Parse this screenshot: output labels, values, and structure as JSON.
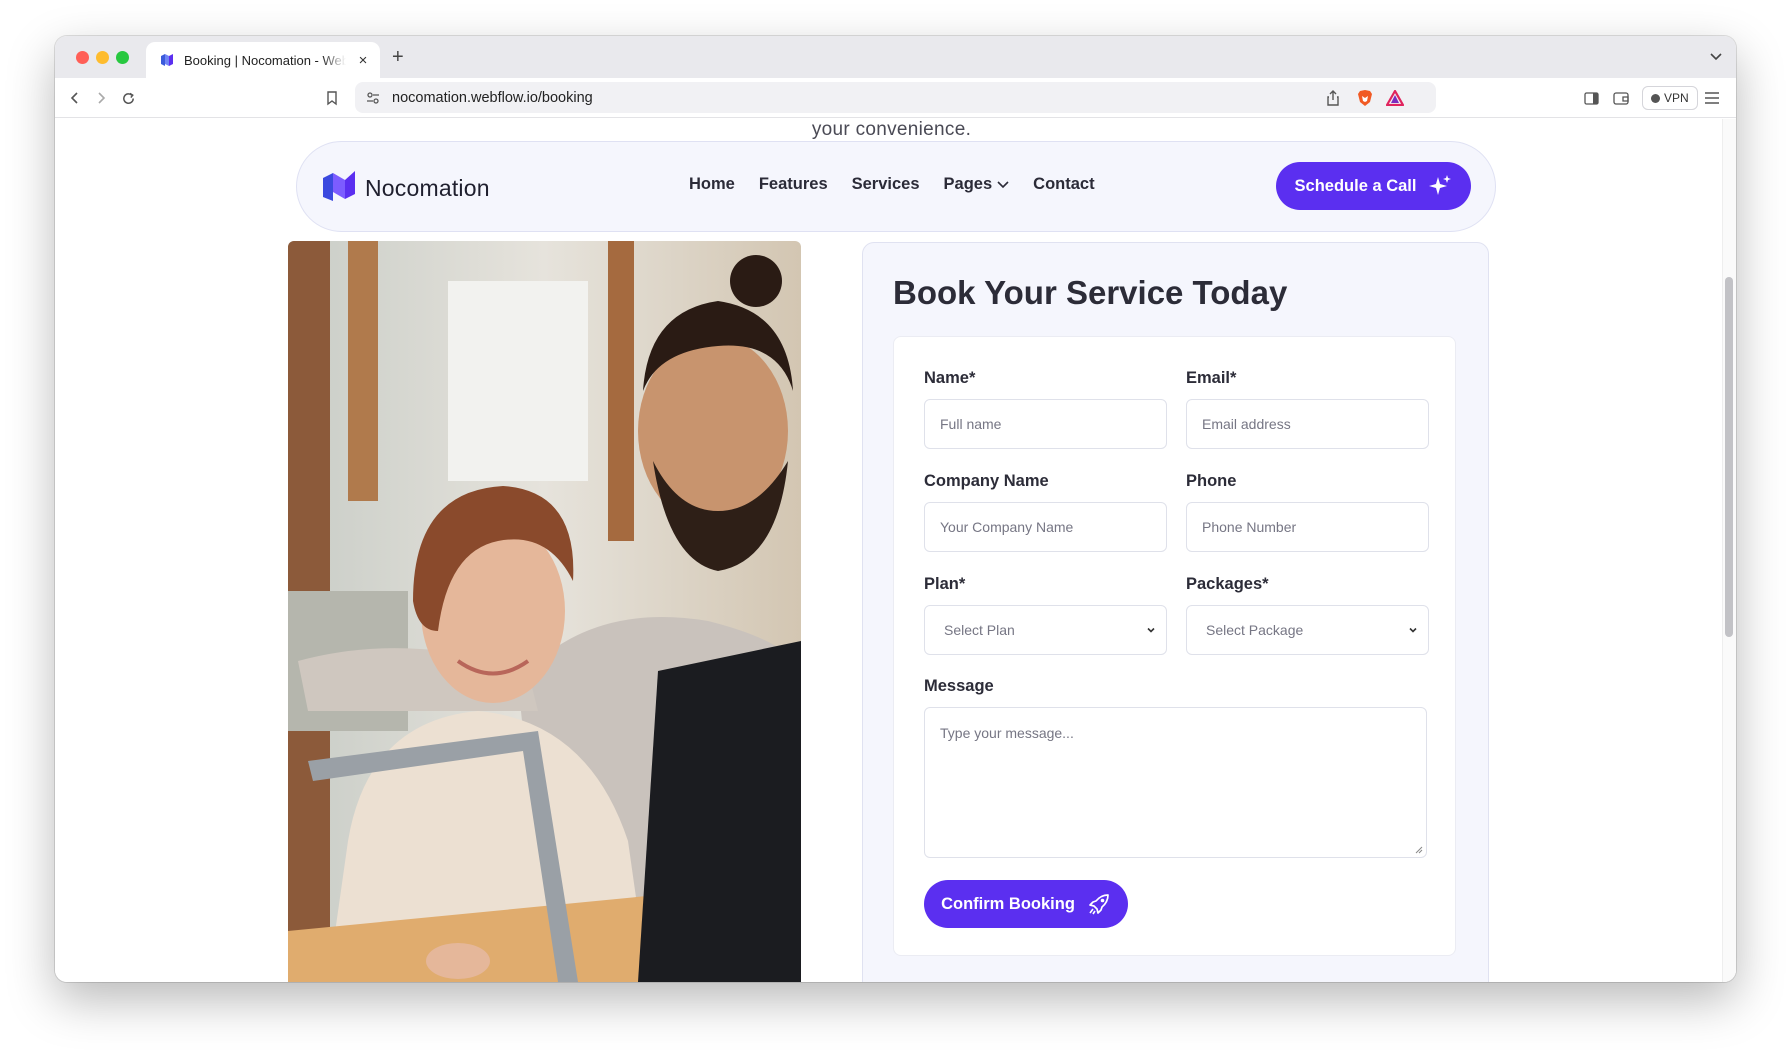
{
  "browser": {
    "tab_title": "Booking | Nocomation - Webflow",
    "url": "nocomation.webflow.io/booking",
    "vpn_label": "VPN"
  },
  "page": {
    "top_text": "your convenience.",
    "brand": {
      "name": "Nocomation",
      "color": "#5b2ff0"
    },
    "nav": {
      "links": [
        "Home",
        "Features",
        "Services",
        "Pages",
        "Contact"
      ],
      "cta_label": "Schedule a Call"
    },
    "form": {
      "title": "Book Your Service Today",
      "name_label": "Name*",
      "name_placeholder": "Full name",
      "email_label": "Email*",
      "email_placeholder": "Email address",
      "company_label": "Company Name",
      "company_placeholder": "Your Company Name",
      "phone_label": "Phone",
      "phone_placeholder": "Phone  Number",
      "plan_label": "Plan*",
      "plan_selected": "Select Plan",
      "packages_label": "Packages*",
      "packages_selected": "Select Package",
      "message_label": "Message",
      "message_placeholder": "Type your message...",
      "submit_label": "Confirm Booking"
    }
  }
}
